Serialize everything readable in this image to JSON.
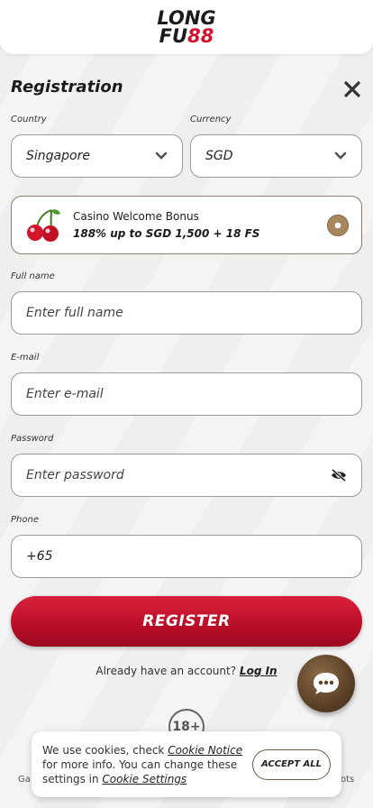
{
  "header": {
    "logo_line1": "LONG",
    "logo_line2_a": "FU",
    "logo_line2_b": "88"
  },
  "form": {
    "title": "Registration",
    "country_label": "Country",
    "country_value": "Singapore",
    "currency_label": "Currency",
    "currency_value": "SGD",
    "bonus_title": "Casino Welcome Bonus",
    "bonus_desc": "188% up to SGD 1,500 + 18 FS",
    "fullname_label": "Full name",
    "fullname_placeholder": "Enter full name",
    "email_label": "E-mail",
    "email_placeholder": "Enter e-mail",
    "password_label": "Password",
    "password_placeholder": "Enter password",
    "phone_label": "Phone",
    "phone_value": "+65",
    "register_label": "REGISTER",
    "already_text": "Already have an account?",
    "login_link": "Log In"
  },
  "footer": {
    "age_badge": "18+",
    "peek_left": "Ga",
    "peek_right": "ots"
  },
  "cookie": {
    "text_1": "We use cookies, check ",
    "notice_link": "Cookie Notice",
    "text_2": " for more info. You can change these settings in ",
    "settings_link": "Cookie Settings",
    "accept_label": "ACCEPT ALL"
  },
  "colors": {
    "brand_red": "#d4112e",
    "accent_brown": "#5a4027"
  },
  "icons": [
    "close-icon",
    "chevron-down-icon",
    "cherry-icon",
    "eye-off-icon",
    "chat-icon"
  ]
}
